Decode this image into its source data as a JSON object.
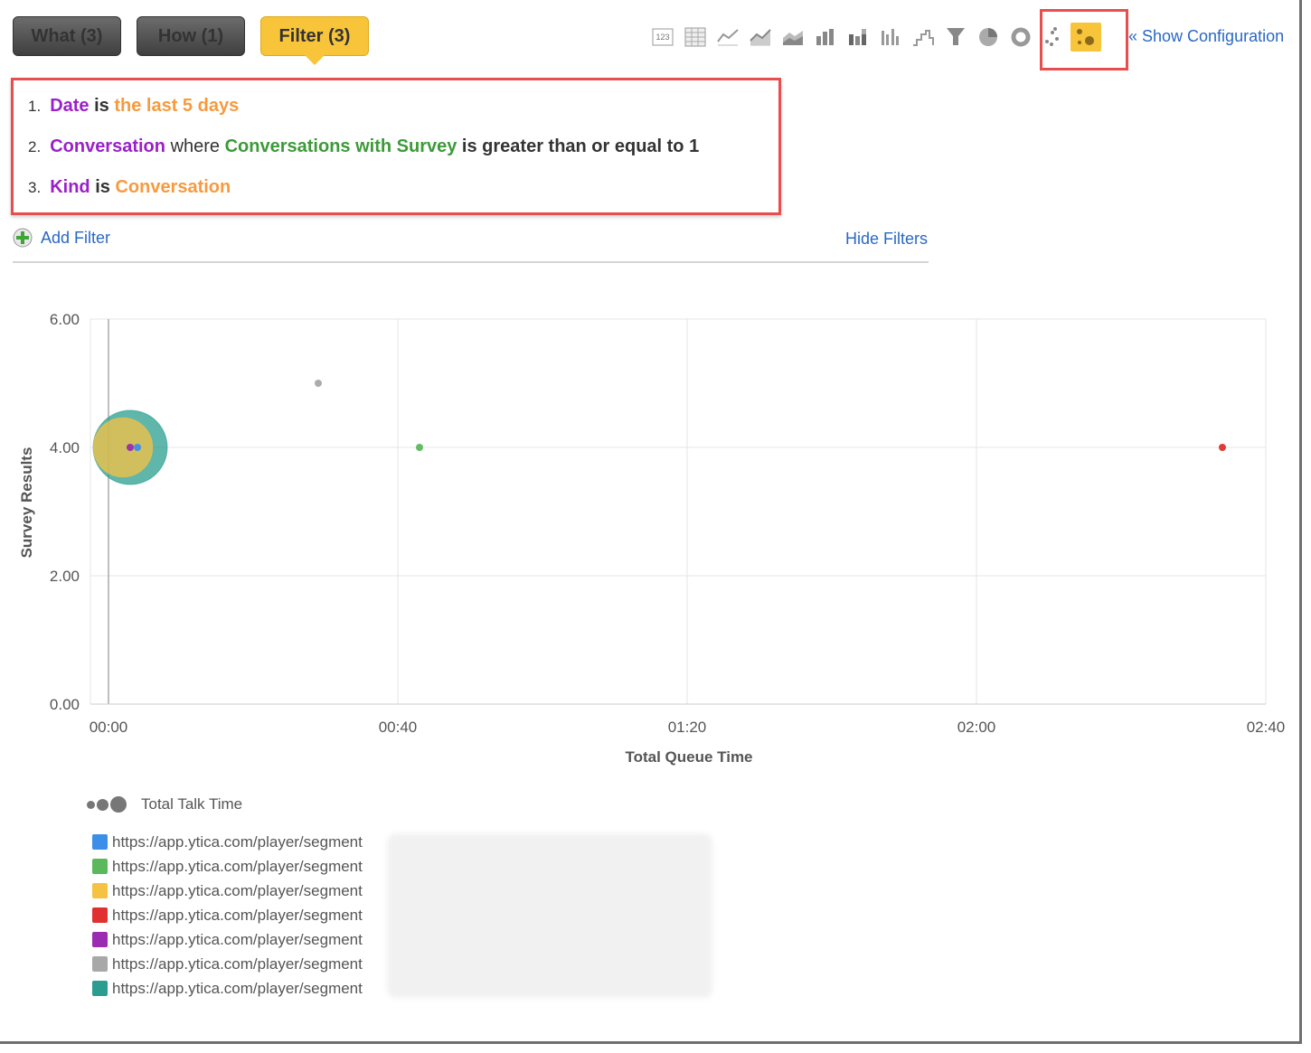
{
  "tabs": [
    {
      "label": "What (3)",
      "active": false
    },
    {
      "label": "How (1)",
      "active": false
    },
    {
      "label": "Filter (3)",
      "active": true
    }
  ],
  "toolbar": {
    "chart_types": [
      "number-icon",
      "table-icon",
      "line-icon",
      "line-area-icon",
      "area-icon",
      "bar-icon",
      "stacked-bar-icon",
      "column-icon",
      "step-icon",
      "funnel-icon",
      "pie-icon",
      "donut-icon",
      "scatter-icon",
      "bubble-icon"
    ],
    "selected": "bubble-icon",
    "show_configuration": "« Show Configuration"
  },
  "filters": [
    {
      "num": "1.",
      "field": "Date",
      "op": "is",
      "value": "the last 5 days"
    },
    {
      "num": "2.",
      "field": "Conversation",
      "where": "where",
      "sub_field": "Conversations with Survey",
      "op": "is greater than or equal to 1"
    },
    {
      "num": "3.",
      "field": "Kind",
      "op": "is",
      "value": "Conversation"
    }
  ],
  "actions": {
    "add_filter": "Add Filter",
    "hide_filters": "Hide Filters"
  },
  "chart_data": {
    "type": "scatter",
    "subtype": "bubble",
    "xlabel": "Total Queue Time",
    "ylabel": "Survey Results",
    "size_label": "Total Talk Time",
    "xticks": [
      "00:00",
      "00:40",
      "01:20",
      "02:00",
      "02:40"
    ],
    "xlim_seconds": [
      0,
      160
    ],
    "yticks": [
      "0.00",
      "2.00",
      "4.00",
      "6.00"
    ],
    "ylim": [
      0,
      6
    ],
    "grid": true,
    "legend_position": "bottom",
    "series": [
      {
        "name": "https://app.ytica.com/player/segment",
        "color": "#3d8ee8",
        "points": [
          {
            "x_seconds": 4,
            "y": 4,
            "size": 1
          }
        ]
      },
      {
        "name": "https://app.ytica.com/player/segment",
        "color": "#5cb85c",
        "points": [
          {
            "x_seconds": 43,
            "y": 4,
            "size": 1
          }
        ]
      },
      {
        "name": "https://app.ytica.com/player/segment",
        "color": "#f5c242",
        "points": [
          {
            "x_seconds": 2,
            "y": 4,
            "size": 8
          }
        ]
      },
      {
        "name": "https://app.ytica.com/player/segment",
        "color": "#e03030",
        "points": [
          {
            "x_seconds": 154,
            "y": 4,
            "size": 1
          }
        ]
      },
      {
        "name": "https://app.ytica.com/player/segment",
        "color": "#9b2bb0",
        "points": [
          {
            "x_seconds": 3,
            "y": 4,
            "size": 1
          }
        ]
      },
      {
        "name": "https://app.ytica.com/player/segment",
        "color": "#a8a8a8",
        "points": [
          {
            "x_seconds": 29,
            "y": 5,
            "size": 1
          }
        ]
      },
      {
        "name": "https://app.ytica.com/player/segment",
        "color": "#2a9d8f",
        "points": [
          {
            "x_seconds": 3,
            "y": 4,
            "size": 10
          }
        ]
      }
    ]
  }
}
